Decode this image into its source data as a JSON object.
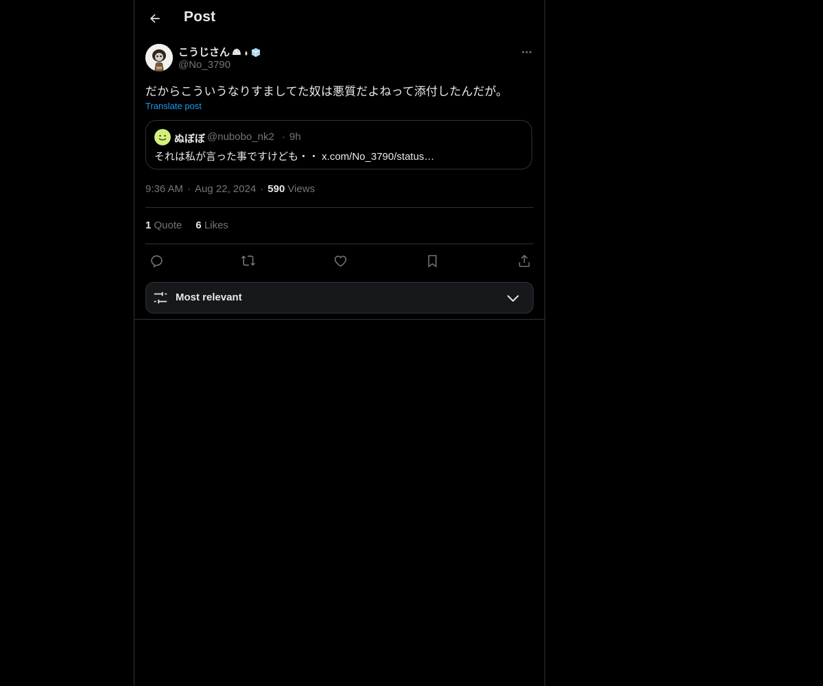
{
  "header": {
    "title": "Post"
  },
  "post": {
    "author_name": "こうじさん",
    "author_handle": "@No_3790",
    "text": "だからこういうなりすましてた奴は悪質だよねって添付したんだが。",
    "translate_label": "Translate post",
    "time": "9:36 AM",
    "date": "Aug 22, 2024",
    "views_count": "590",
    "views_label": "Views"
  },
  "quote": {
    "name": "ぬぼぼ",
    "handle": "@nubobo_nk2",
    "separator": "·",
    "time": "9h",
    "text": "それは私が言った事ですけども・・ x.com/No_3790/status…"
  },
  "stats": {
    "quotes_count": "1",
    "quotes_label": "Quote",
    "likes_count": "6",
    "likes_label": "Likes"
  },
  "sort": {
    "label": "Most relevant"
  },
  "colors": {
    "background": "#000000",
    "border": "#2f3336",
    "text_primary": "#e7e9ea",
    "text_secondary": "#71767b",
    "link": "#1d9bf0",
    "sort_bg": "#16181c"
  },
  "icons": {
    "back": "arrow-left-icon",
    "more": "more-horizontal-icon",
    "reply": "reply-icon",
    "repost": "repost-icon",
    "like": "heart-icon",
    "bookmark": "bookmark-icon",
    "share": "share-icon",
    "sort": "sliders-icon",
    "chevron": "chevron-down-icon"
  }
}
